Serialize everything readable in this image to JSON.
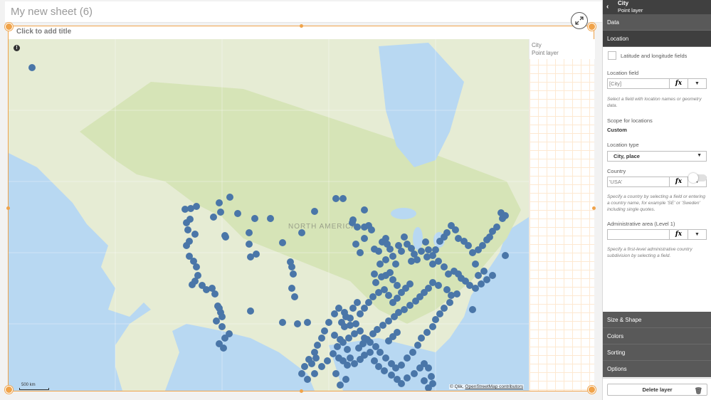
{
  "sheet": {
    "title": "My new sheet (6)",
    "add_title": "Click to add title"
  },
  "legend": {
    "title": "City",
    "subtitle": "Point layer"
  },
  "map": {
    "label": "NORTH AMERICA",
    "scale": "500 km",
    "attribution_prefix": "© Qlik,",
    "attribution_link": "OpenStreetMap contributors",
    "point_color": "#4a76a8",
    "point_count": 259
  },
  "panel": {
    "back_icon": "chevron-left-icon",
    "layer_name": "City",
    "layer_type": "Point layer",
    "sections": {
      "data": "Data",
      "location": "Location",
      "size_shape": "Size & Shape",
      "colors": "Colors",
      "sorting": "Sorting",
      "options": "Options"
    },
    "latlong_label": "Latitude and longitude fields",
    "location_field_label": "Location field",
    "location_field_value": "[City]",
    "location_field_help": "Select a field with location names or geometry data.",
    "scope_label": "Scope for locations",
    "scope_value": "Custom",
    "location_type_label": "Location type",
    "location_type_value": "City, place",
    "country_label": "Country",
    "country_value": "'USA'",
    "country_help": "Specify a country by selecting a field or entering a country name, for example 'SE' or 'Sweden' including single quotes.",
    "admin_label": "Administrative area (Level 1)",
    "admin_value": "",
    "admin_help": "Specify a first-level administrative country subdivision by selecting a field.",
    "fx": "fx",
    "dropdown_arrow": "▼",
    "delete_label": "Delete layer"
  },
  "colors": {
    "accent": "#f0a34a",
    "panel_dark": "#404040",
    "panel_mid": "#595959",
    "water": "#b8d8f2",
    "land": "#e8ecd7"
  }
}
